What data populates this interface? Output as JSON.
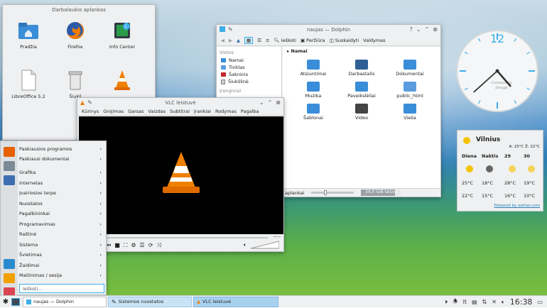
{
  "folder_view": {
    "title": "Darbalaukio aplankas",
    "items": [
      {
        "label": "Pradžia",
        "icon": "home-folder-icon",
        "color": "#3a8dd8"
      },
      {
        "label": "Firefox",
        "icon": "firefox-icon",
        "color": "#e66000"
      },
      {
        "label": "Info Center",
        "icon": "info-center-icon",
        "color": "#2a9d4a"
      },
      {
        "label": "LibreOffice 5.2",
        "icon": "libreoffice-icon",
        "color": "#ffffff"
      },
      {
        "label": "Šiukš",
        "icon": "trash-icon",
        "color": "#cccccc"
      },
      {
        "label": "",
        "icon": "vlc-icon",
        "color": "#f08000"
      }
    ]
  },
  "dolphin": {
    "title": "naujas — Dolphin",
    "toolbar": {
      "search": "Ieškoti",
      "preview": "Peržiūra",
      "split": "Suskaidyti",
      "menu": "Valdymas"
    },
    "places_header": "Vietos",
    "places": [
      "Namai",
      "Tinklas",
      "Šakninis",
      "Šiukšlinė"
    ],
    "recent_header": "Įrenginiai",
    "breadcrumb": "Namai",
    "files": [
      "Atsiuntimai",
      "Darbastalis",
      "Dokumentai",
      "Muzika",
      "Paveikslėliai",
      "public_html",
      "Šablonai",
      "Video",
      "Vieša"
    ],
    "status_left": "aplankai",
    "status_right": "34,0 GiB laisva"
  },
  "vlc": {
    "title": "VLC leistuvė",
    "menu": [
      "Kūrinys",
      "Grojimas",
      "Garsas",
      "Vaizdas",
      "Subtitrai",
      "Įrankiai",
      "Rodymas",
      "Pagalba"
    ],
    "time_right": "--:--"
  },
  "launcher": {
    "top": [
      "Paskiausios programos",
      "Paskiausi dokumentai"
    ],
    "categories": [
      "Grafika",
      "Internetas",
      "Įvairiosios terpe",
      "Nuostatos",
      "Pagalbininkai",
      "Programavimas",
      "Raštinė",
      "Sistema",
      "Švietimas",
      "Žaidimai",
      "Maitinimas / sesija"
    ],
    "search_placeholder": "Ieškoti..."
  },
  "clock": {
    "number": "12",
    "brand_line1": "Community",
    "brand_line2": "Design",
    "hour": 4,
    "minute": 38
  },
  "weather": {
    "city": "Vilnius",
    "range": "A: 25°C Ž: 22°C",
    "cols": [
      "Diena",
      "Naktis",
      "29",
      "30"
    ],
    "row1": [
      "25°C",
      "18°C",
      "28°C",
      "19°C"
    ],
    "row2": [
      "22°C",
      "15°C",
      "16°C",
      "10°C"
    ],
    "source": "Powered by wetter.com"
  },
  "taskbar": {
    "items": [
      "naujas — Dolphin",
      "Sistemos nuostatos",
      "VLC leistuvė"
    ],
    "time": "16:38"
  }
}
